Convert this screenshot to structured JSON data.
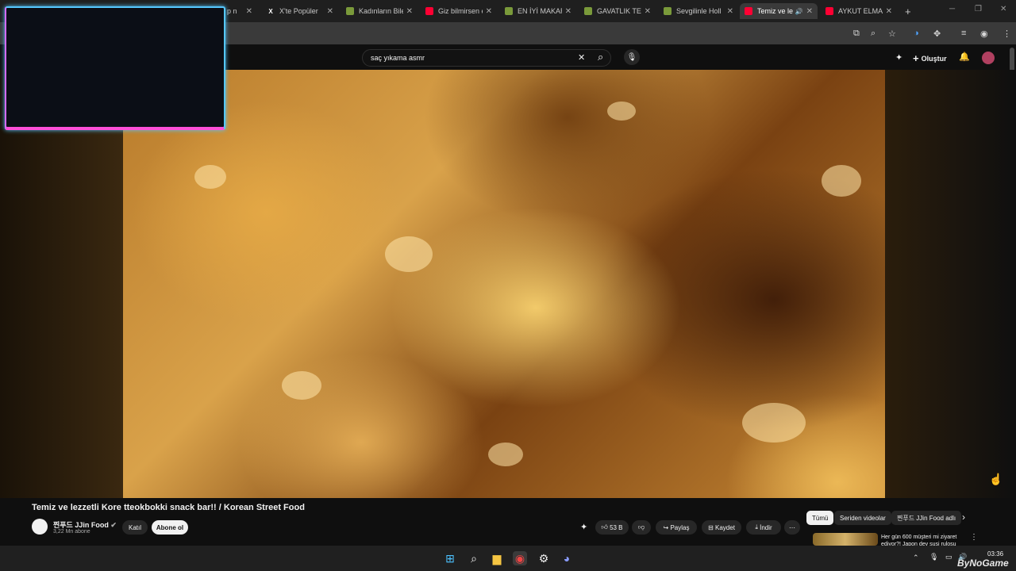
{
  "tabs": [
    {
      "label": "p n",
      "icon": "youtube-icon"
    },
    {
      "label": "X'te Popüler",
      "icon": "x-icon"
    },
    {
      "label": "Kadınların Bile",
      "icon": "site-icon"
    },
    {
      "label": "Giz bilmirsen e",
      "icon": "youtube-icon"
    },
    {
      "label": "EN İYİ MAKAR",
      "icon": "site-icon"
    },
    {
      "label": "GAVATLIK TEST",
      "icon": "site-icon"
    },
    {
      "label": "Sevgilinle Holl",
      "icon": "site-icon"
    },
    {
      "label": "Temiz ve le",
      "icon": "youtube-icon",
      "active": true
    },
    {
      "label": "AYKUT ELMAS",
      "icon": "youtube-icon"
    }
  ],
  "search": {
    "value": "saç yıkama asmr"
  },
  "header": {
    "create_label": "Oluştur"
  },
  "video": {
    "title": "Temiz ve lezzetli Kore tteokbokki snack bar!! / Korean Street Food",
    "channel": "찐푸드 JJin Food",
    "subscribers": "3,22 Mn abone",
    "join_label": "Katıl",
    "subscribe_label": "Abone ol",
    "likes": "53 B",
    "share_label": "Paylaş",
    "save_label": "Kaydet",
    "download_label": "İndir"
  },
  "chips": [
    "Tümü",
    "Seriden videolar",
    "찐푸드 JJin Food adlı"
  ],
  "recommendation": {
    "title": "Her gün 600 müşteri mi ziyaret ediyor?! Japon dev suşi ruloşu"
  },
  "taskbar": {
    "time": "03:36"
  },
  "watermark": "ByNoGame"
}
